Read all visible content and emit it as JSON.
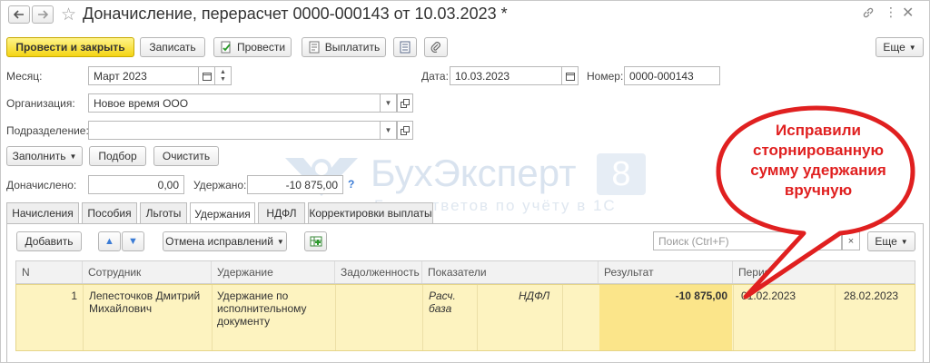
{
  "window": {
    "title": "Доначисление, перерасчет 0000-000143 от 10.03.2023 *"
  },
  "toolbar": {
    "post_close": "Провести и закрыть",
    "save": "Записать",
    "post": "Провести",
    "pay": "Выплатить",
    "more": "Еще"
  },
  "form": {
    "month_label": "Месяц:",
    "month_value": "Март 2023",
    "date_label": "Дата:",
    "date_value": "10.03.2023",
    "number_label": "Номер:",
    "number_value": "0000-000143",
    "org_label": "Организация:",
    "org_value": "Новое время ООО",
    "dept_label": "Подразделение:",
    "dept_value": ""
  },
  "actions": {
    "fill": "Заполнить",
    "pick": "Подбор",
    "clear": "Очистить"
  },
  "totals": {
    "accrued_label": "Доначислено:",
    "accrued_value": "0,00",
    "withheld_label": "Удержано:",
    "withheld_value": "-10 875,00",
    "help": "?"
  },
  "tabs": [
    "Начисления",
    "Пособия",
    "Льготы",
    "Удержания",
    "НДФЛ",
    "Корректировки выплаты"
  ],
  "grid_toolbar": {
    "add": "Добавить",
    "undo_fix": "Отмена исправлений",
    "search_placeholder": "Поиск (Ctrl+F)",
    "search_clear": "×",
    "more": "Еще"
  },
  "table": {
    "headers": [
      "N",
      "Сотрудник",
      "Удержание",
      "Задолженность",
      "Показатели",
      "Результат",
      "Период"
    ],
    "row": {
      "n": "1",
      "employee_line1": "Лепесточков Дмитрий",
      "employee_line2": "Михайлович",
      "deduction_line1": "Удержание по",
      "deduction_line2": "исполнительному",
      "deduction_line3": "документу",
      "indicator_line1": "Расч.",
      "indicator_line2": "база",
      "indicator_name": "НДФЛ",
      "result": "-10 875,00",
      "period_from": "01.02.2023",
      "period_to": "28.02.2023"
    }
  },
  "watermark": {
    "brand": "БухЭксперт",
    "digit": "8",
    "tagline": "Базa ответов по учёту в 1С"
  },
  "callout": {
    "line1": "Исправили",
    "line2": "сторнированную",
    "line3": "сумму удержания",
    "line4": "вручную"
  },
  "colors": {
    "primary_button": "#f4d414",
    "selected_row": "#fdf3c0",
    "selected_cell": "#fbe58a",
    "callout_fill": "#ffffff",
    "callout_stroke": "#e02020",
    "callout_text": "#e02020",
    "watermark": "#d9e3ef"
  }
}
